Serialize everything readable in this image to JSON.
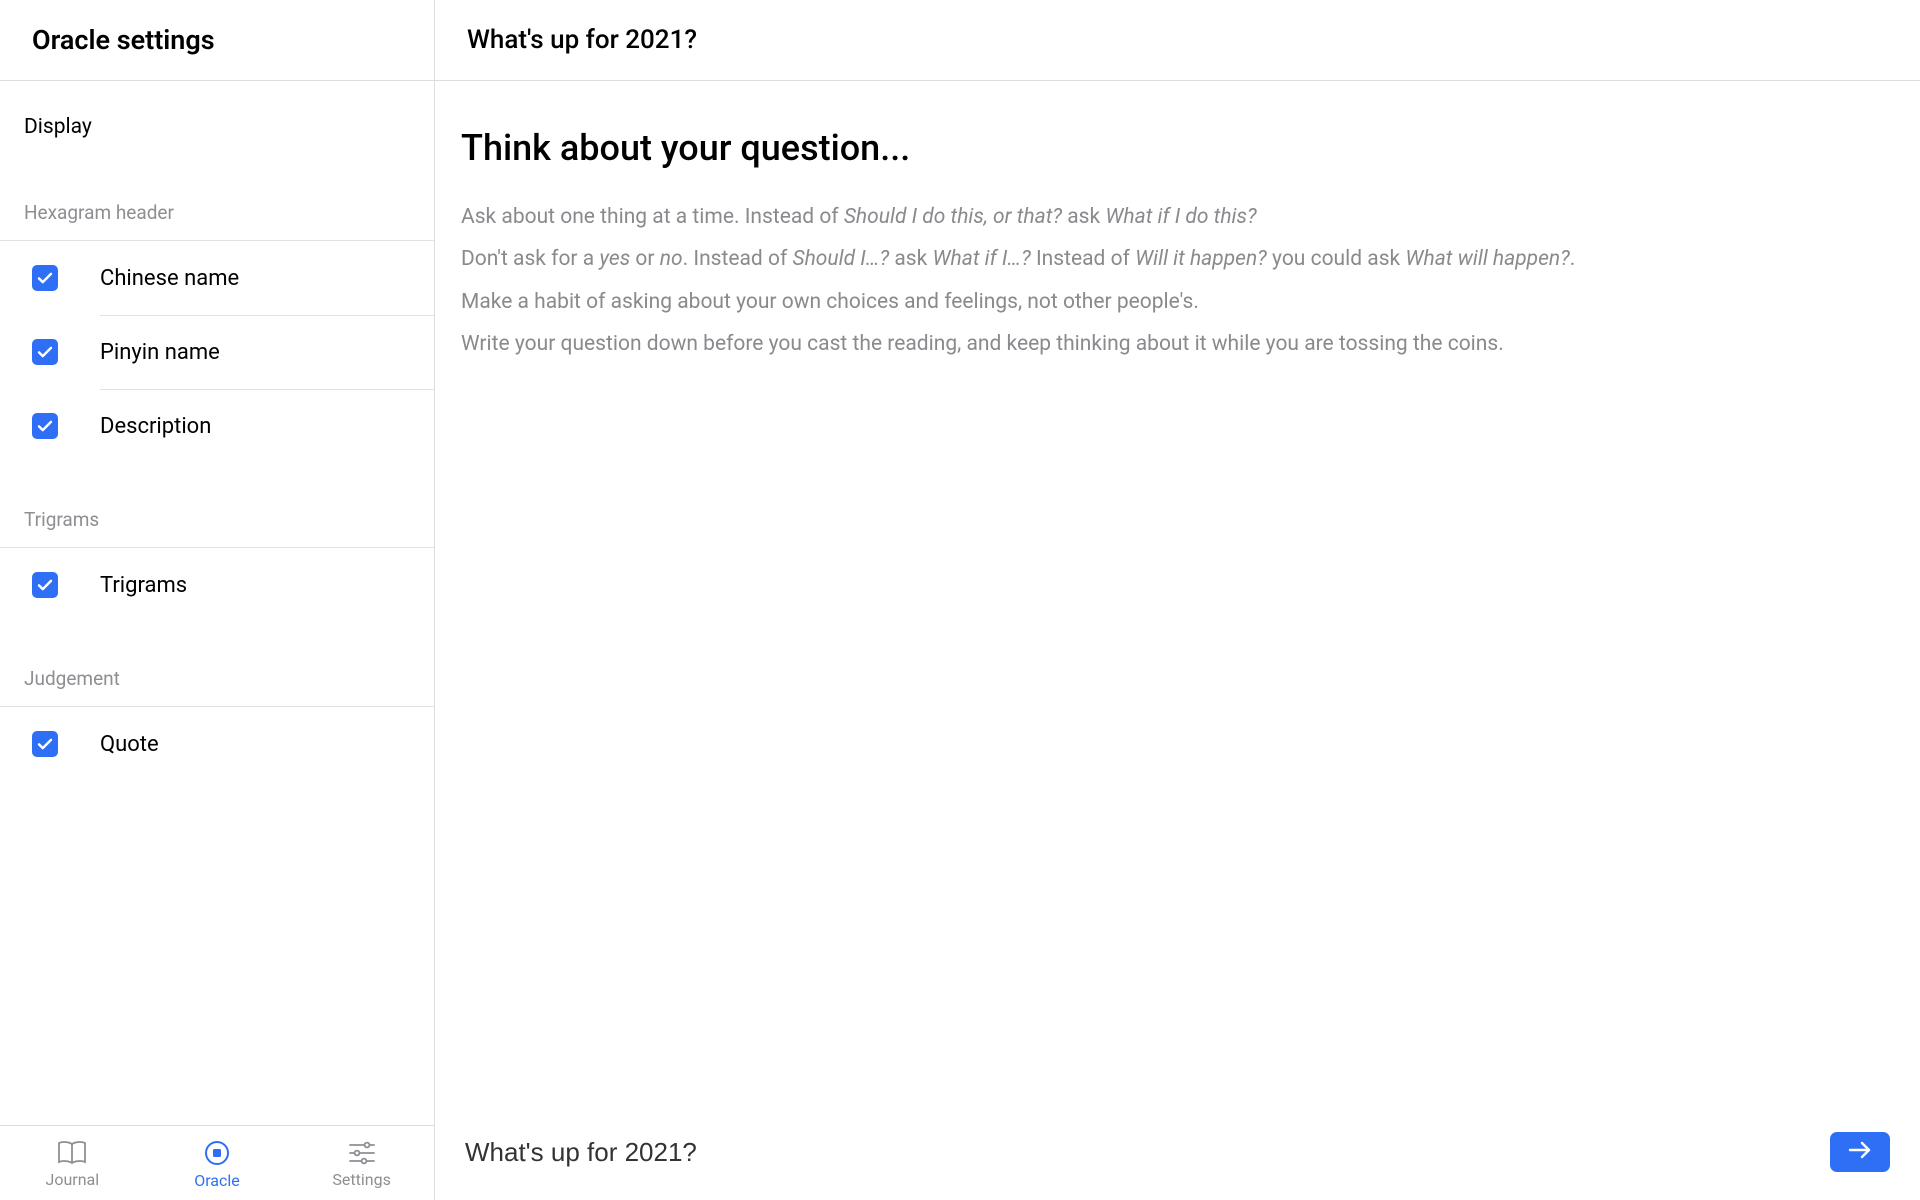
{
  "sidebar": {
    "title": "Oracle settings",
    "section_label": "Display",
    "groups": [
      {
        "label": "Hexagram header",
        "items": [
          {
            "label": "Chinese name",
            "checked": true
          },
          {
            "label": "Pinyin name",
            "checked": true
          },
          {
            "label": "Description",
            "checked": true
          }
        ]
      },
      {
        "label": "Trigrams",
        "items": [
          {
            "label": "Trigrams",
            "checked": true
          }
        ]
      },
      {
        "label": "Judgement",
        "items": [
          {
            "label": "Quote",
            "checked": true
          }
        ]
      }
    ]
  },
  "nav": {
    "items": [
      {
        "label": "Journal",
        "icon": "book-icon",
        "active": false
      },
      {
        "label": "Oracle",
        "icon": "oracle-icon",
        "active": true
      },
      {
        "label": "Settings",
        "icon": "sliders-icon",
        "active": false
      }
    ]
  },
  "main": {
    "header_title": "What's up for 2021?",
    "heading": "Think about your question...",
    "tips_html": "<p>Ask about one thing at a time. Instead of <em>Should I do this, or that?</em> ask <em>What if I do this?</em></p><p>Don't ask for a <em>yes</em> or <em>no</em>. Instead of <em>Should I…?</em> ask <em>What if I…?</em> Instead of <em>Will it happen?</em> you could ask <em>What will happen?</em>.</p><p>Make a habit of asking about your own choices and feelings, not other people's.</p><p>Write your question down before you cast the reading, and keep thinking about it while you are tossing the coins.</p>",
    "input_value": "What's up for 2021?"
  },
  "colors": {
    "accent": "#2e6ff6"
  }
}
